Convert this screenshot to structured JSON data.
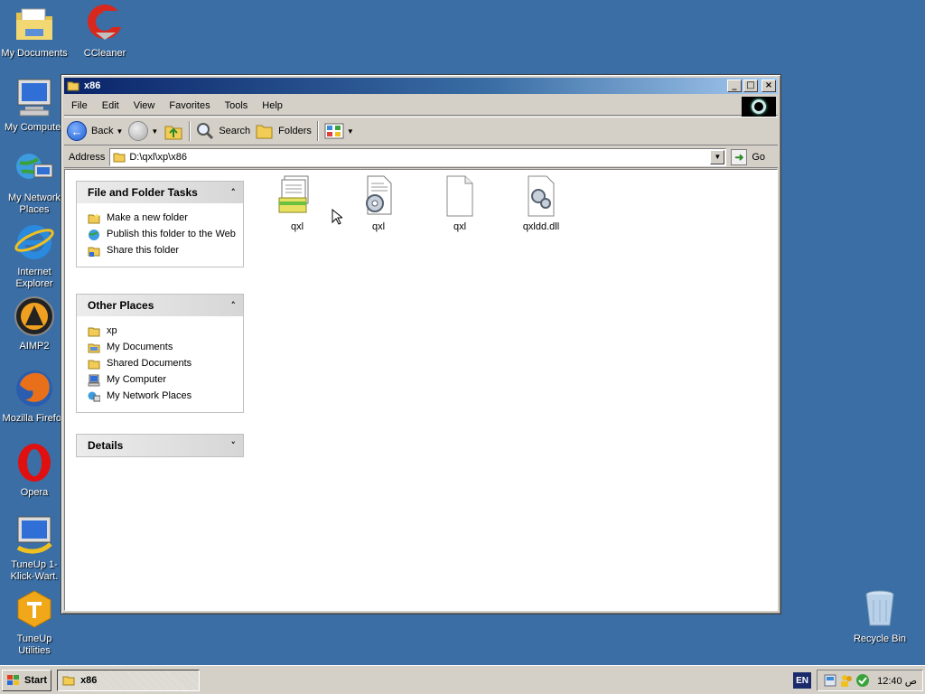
{
  "desktop": {
    "icons": [
      {
        "label": "My Documents"
      },
      {
        "label": "CCleaner"
      },
      {
        "label": "My Computer"
      },
      {
        "label": "My Network Places"
      },
      {
        "label": "Internet Explorer"
      },
      {
        "label": "AIMP2"
      },
      {
        "label": "Mozilla Firefox"
      },
      {
        "label": "Opera"
      },
      {
        "label": "TuneUp 1-Klick-Wart."
      },
      {
        "label": "TuneUp Utilities"
      },
      {
        "label": "Recycle Bin"
      }
    ]
  },
  "window": {
    "title": "x86",
    "controls": {
      "minimize": "_",
      "maximize": "□",
      "close": "×"
    },
    "menu": [
      "File",
      "Edit",
      "View",
      "Favorites",
      "Tools",
      "Help"
    ],
    "toolbar": {
      "back": "Back",
      "search": "Search",
      "folders": "Folders"
    },
    "address": {
      "label": "Address",
      "value": "D:\\qxl\\xp\\x86",
      "go": "Go"
    },
    "task_pane": {
      "file_tasks": {
        "title": "File and Folder Tasks",
        "items": [
          "Make a new folder",
          "Publish this folder to the Web",
          "Share this folder"
        ]
      },
      "other_places": {
        "title": "Other Places",
        "items": [
          "xp",
          "My Documents",
          "Shared Documents",
          "My Computer",
          "My Network Places"
        ]
      },
      "details": {
        "title": "Details"
      }
    },
    "files": [
      {
        "name": "qxl",
        "icon": "setup-info-icon"
      },
      {
        "name": "qxl",
        "icon": "system-file-icon"
      },
      {
        "name": "qxl",
        "icon": "blank-file-icon"
      },
      {
        "name": "qxldd.dll",
        "icon": "dll-file-icon"
      }
    ]
  },
  "taskbar": {
    "start": "Start",
    "items": [
      {
        "label": "x86"
      }
    ],
    "language": "EN",
    "clock": "12:40 ص"
  },
  "colors": {
    "desktop": "#3a6ea5",
    "titlebar_start": "#0a246a",
    "titlebar_end": "#a6caf0"
  }
}
